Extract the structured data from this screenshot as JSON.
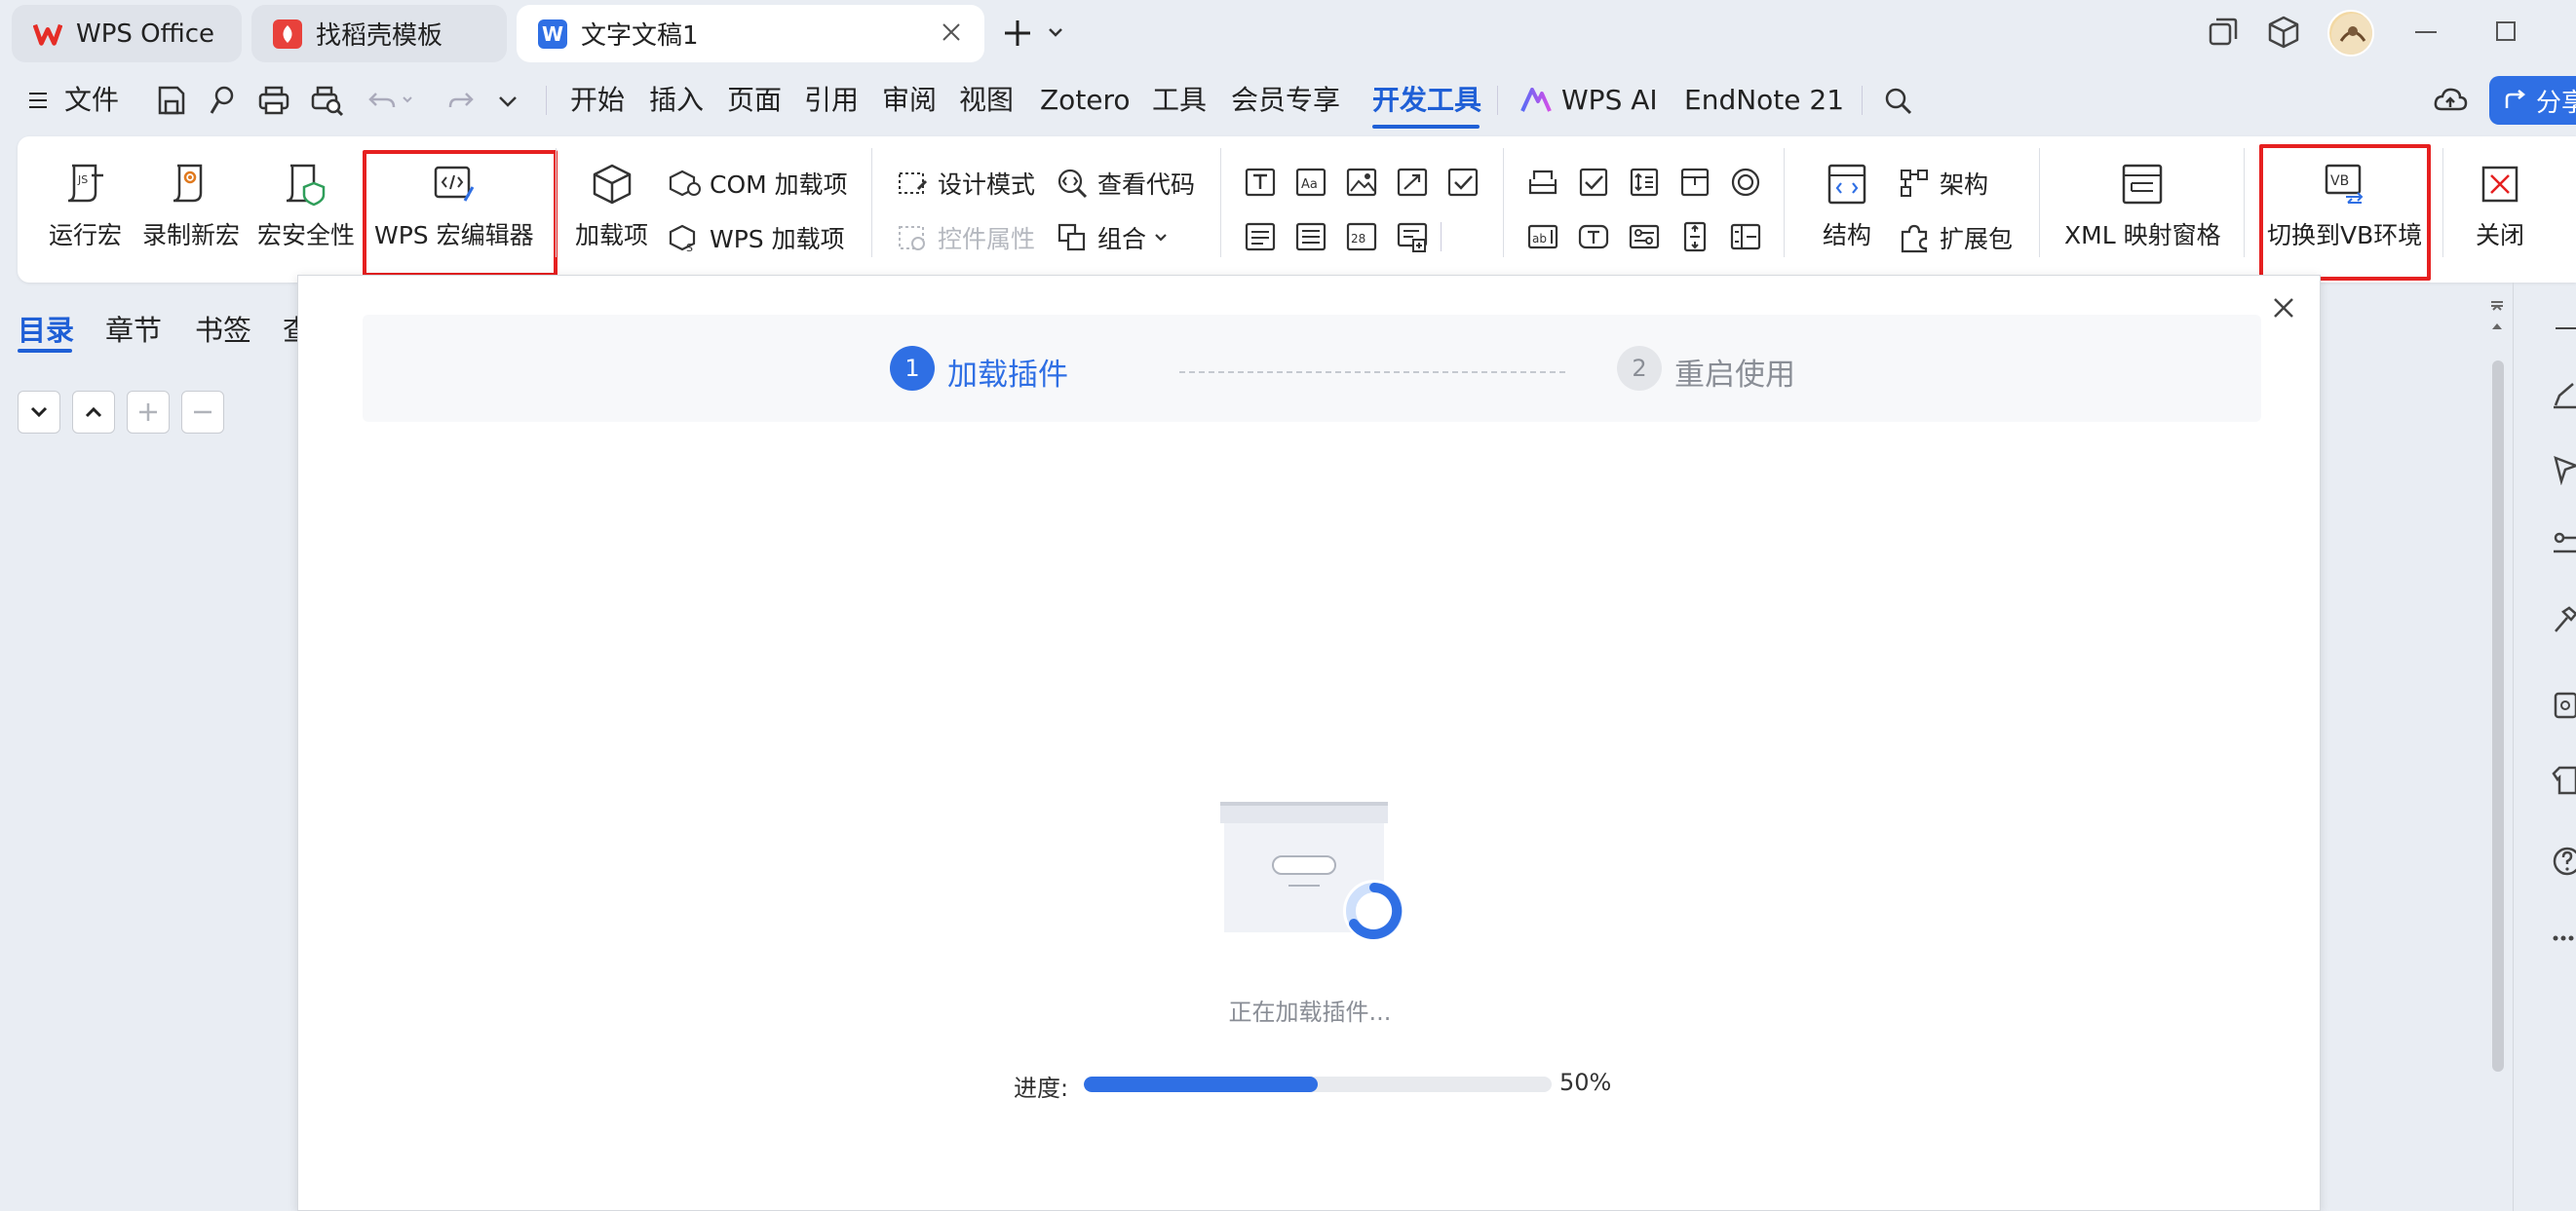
{
  "tabs": [
    {
      "label": "WPS Office",
      "icon": "wps-logo-icon"
    },
    {
      "label": "找稻壳模板",
      "icon": "docer-icon"
    },
    {
      "label": "文字文稿1",
      "icon": "word-doc-icon",
      "active": true
    }
  ],
  "menu": {
    "file": "文件",
    "items": [
      "开始",
      "插入",
      "页面",
      "引用",
      "审阅",
      "视图",
      "Zotero",
      "工具",
      "会员专享",
      "开发工具",
      "WPS AI",
      "EndNote 21"
    ],
    "active": "开发工具",
    "share": "分享"
  },
  "ribbon": {
    "run_macro": "运行宏",
    "record_macro": "录制新宏",
    "macro_security": "宏安全性",
    "wps_macro_editor": "WPS 宏编辑器",
    "addins": "加载项",
    "com_addins": "COM 加载项",
    "wps_addins": "WPS 加载项",
    "design_mode": "设计模式",
    "view_code": "查看代码",
    "control_props": "控件属性",
    "group": "组合",
    "structure": "结构",
    "schema": "架构",
    "expansion_pack": "扩展包",
    "xml_mapping": "XML 映射窗格",
    "switch_vb": "切换到VB环境",
    "close": "关闭"
  },
  "nav_pane": {
    "tabs": [
      "目录",
      "章节",
      "书签",
      "查"
    ],
    "active": "目录"
  },
  "dialog": {
    "step1_num": "1",
    "step1_label": "加载插件",
    "step2_num": "2",
    "step2_label": "重启使用",
    "loading_text": "正在加载插件...",
    "progress_label": "进度:",
    "progress_value": 0.5,
    "progress_text": "50%"
  },
  "colors": {
    "accent": "#2f6fe4",
    "highlight_border": "#e62020",
    "progress_track": "#e8eaee"
  }
}
